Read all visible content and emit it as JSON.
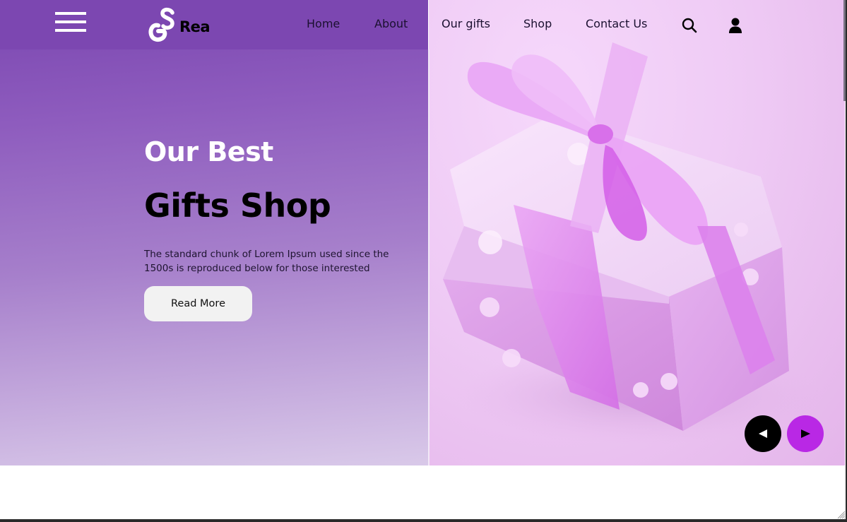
{
  "header": {
    "logo_text": "Rea",
    "logo_mark": "GS",
    "nav": [
      "Home",
      "About",
      "Our gifts",
      "Shop",
      "Contact Us"
    ],
    "icons": {
      "menu": "hamburger-icon",
      "search": "search-icon",
      "user": "user-icon"
    }
  },
  "hero": {
    "title_line1": "Our Best",
    "title_line2": "Gifts Shop",
    "description": "The standard chunk of Lorem Ipsum used since the 1500s is reproduced below for those interested",
    "button_label": "Read More",
    "image_alt": "Pink polka-dot gift box with satin ribbon bow",
    "slider": {
      "prev_icon": "triangle-left-icon",
      "next_icon": "triangle-right-icon"
    }
  },
  "colors": {
    "header_purple": "#7c47b1",
    "accent_purple": "#b928e5",
    "prev_button": "#000000",
    "button_bg": "#f2f2f2"
  }
}
